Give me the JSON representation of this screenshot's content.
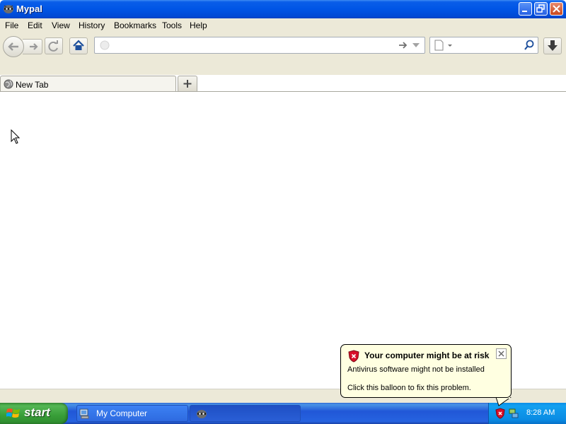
{
  "window": {
    "title": "Mypal"
  },
  "menu": {
    "items": [
      "File",
      "Edit",
      "View",
      "History",
      "Bookmarks",
      "Tools",
      "Help"
    ]
  },
  "toolbar": {
    "url_value": "",
    "url_placeholder": "",
    "search_value": "",
    "search_placeholder": ""
  },
  "tabs": [
    {
      "label": "New Tab"
    }
  ],
  "taskbar": {
    "start_label": "start",
    "tasks": [
      {
        "label": "My Computer"
      },
      {
        "label": ""
      }
    ],
    "clock": "8:28 AM"
  },
  "balloon": {
    "title": "Your computer might be at risk",
    "line1": "Antivirus software might not be installed",
    "line2": "Click this balloon to fix this problem."
  },
  "colors": {
    "titlebar": "#0055e5",
    "chrome": "#ece9d8",
    "balloon_bg": "#ffffe1",
    "start_green": "#389e38",
    "taskbar_blue": "#2157d7"
  }
}
